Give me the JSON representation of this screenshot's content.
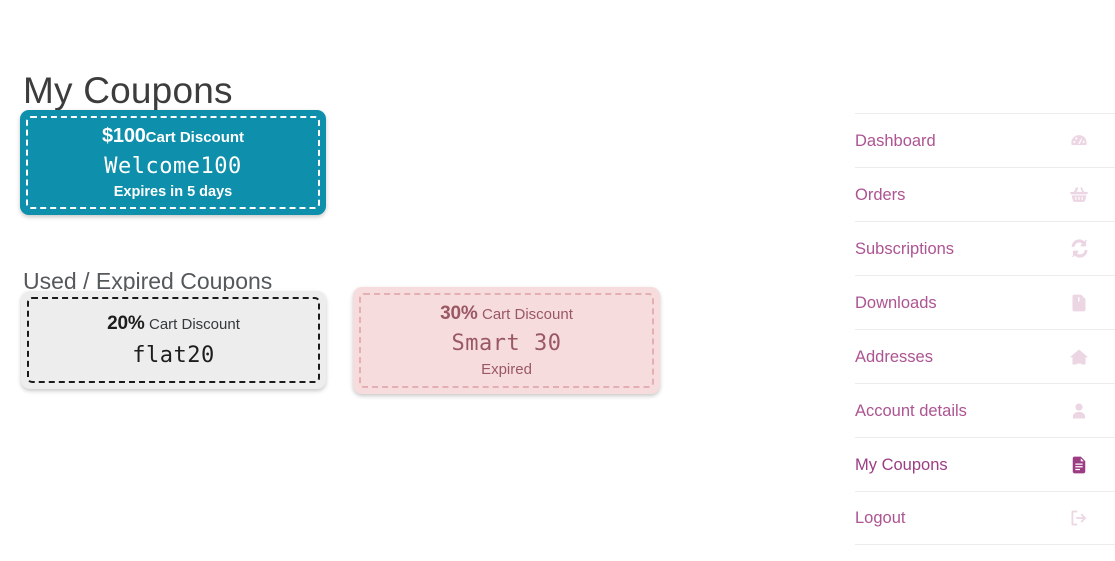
{
  "page": {
    "title": "My Coupons",
    "section_title": "Used / Expired Coupons"
  },
  "coupons": {
    "active": [
      {
        "amount": "$100",
        "discount_label": "Cart Discount",
        "code": "Welcome100",
        "meta": "Expires in 5 days",
        "state": "active",
        "bg_color": "#0e8fab",
        "text_color": "#ffffff"
      }
    ],
    "used_expired": [
      {
        "amount": "20%",
        "discount_label": "Cart Discount",
        "code": "flat20",
        "meta": "",
        "state": "used",
        "bg_color": "#ededed",
        "text_color": "#1d1d1d"
      },
      {
        "amount": "30%",
        "discount_label": "Cart Discount",
        "code": "Smart 30",
        "meta": "Expired",
        "state": "expired",
        "bg_color": "#f6dcdd",
        "text_color": "#9a5863"
      }
    ]
  },
  "sidebar": {
    "accent_color": "#ad5492",
    "active_color": "#9c3d83",
    "icon_color": "#ecd6e4",
    "items": [
      {
        "label": "Dashboard",
        "icon": "dashboard-icon",
        "active": false
      },
      {
        "label": "Orders",
        "icon": "basket-icon",
        "active": false
      },
      {
        "label": "Subscriptions",
        "icon": "refresh-cycle-icon",
        "active": false
      },
      {
        "label": "Downloads",
        "icon": "file-download-icon",
        "active": false
      },
      {
        "label": "Addresses",
        "icon": "home-icon",
        "active": false
      },
      {
        "label": "Account details",
        "icon": "user-icon",
        "active": false
      },
      {
        "label": "My Coupons",
        "icon": "document-lines-icon",
        "active": true
      },
      {
        "label": "Logout",
        "icon": "logout-arrow-icon",
        "active": false
      }
    ]
  }
}
